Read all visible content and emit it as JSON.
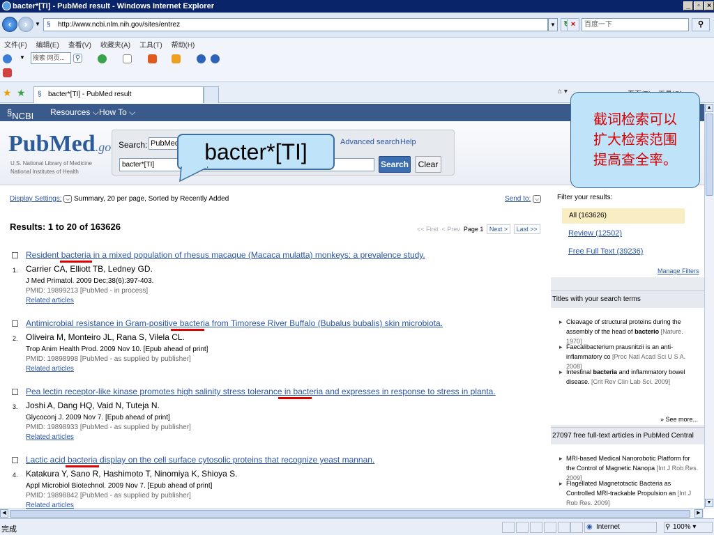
{
  "window": {
    "title": "bacter*[TI] - PubMed result - Windows Internet Explorer"
  },
  "address": {
    "url": "http://www.ncbi.nlm.nih.gov/sites/entrez",
    "search_placeholder": "百度一下"
  },
  "menu": [
    "文件(F)",
    "编辑(E)",
    "查看(V)",
    "收藏夹(A)",
    "工具(T)",
    "帮助(H)"
  ],
  "toolbar": {
    "search_label": "搜索 网页..."
  },
  "tab": {
    "label": "bacter*[TI] - PubMed result",
    "right_tools": "页面(P) ▾  工具(O) ▾"
  },
  "ncbi": {
    "brand": "NCBI",
    "resources": "Resources ⌵",
    "howto": "How To ⌵"
  },
  "pubmed": {
    "logo_pub": "Pub",
    "logo_med": "Med",
    "logo_gov": ".gov",
    "nlm1": "U.S. National Library of Medicine",
    "nlm2": "National Institutes of Health",
    "search_label": "Search:",
    "db_value": "PubMed",
    "advanced": "Advanced search",
    "help": "Help",
    "query": "bacter*[TI]",
    "search_btn": "Search",
    "clear_btn": "Clear"
  },
  "callout_query": "bacter*[TI]",
  "callout_note": [
    "截词检索可以",
    "扩大检索范围",
    "提高查全率。"
  ],
  "results_bar": {
    "display": "Display Settings:",
    "display_desc": "Summary, 20 per page, Sorted by Recently Added",
    "sendto": "Send to:",
    "count": "Results: 1 to 20 of 163626",
    "first": "<< First",
    "prev": "< Prev",
    "page": "Page 1",
    "next": "Next >",
    "last": "Last >>"
  },
  "results": [
    {
      "num": "1.",
      "title": "Resident bacteria in a mixed population of rhesus macaque (Macaca mulatta) monkeys: a prevalence study.",
      "authors": "Carrier CA, Elliott TB, Ledney GD.",
      "journal": "J Med Primatol. 2009 Dec;38(6):397-403.",
      "pmid": "PMID: 19899213 [PubMed - in process]",
      "related": "Related articles"
    },
    {
      "num": "2.",
      "title": "Antimicrobial resistance in Gram-positive bacteria from Timorese River Buffalo (Bubalus bubalis) skin microbiota.",
      "authors": "Oliveira M, Monteiro JL, Rana S, Vilela CL.",
      "journal": "Trop Anim Health Prod. 2009 Nov 10. [Epub ahead of print]",
      "pmid": "PMID: 19898998 [PubMed - as supplied by publisher]",
      "related": "Related articles"
    },
    {
      "num": "3.",
      "title": "Pea lectin receptor-like kinase promotes high salinity stress tolerance in bacteria and expresses in response to stress in planta.",
      "authors": "Joshi A, Dang HQ, Vaid N, Tuteja N.",
      "journal": "Glycoconj J. 2009 Nov 7. [Epub ahead of print]",
      "pmid": "PMID: 19898933 [PubMed - as supplied by publisher]",
      "related": "Related articles"
    },
    {
      "num": "4.",
      "title": "Lactic acid bacteria display on the cell surface cytosolic proteins that recognize yeast mannan.",
      "authors": "Katakura Y, Sano R, Hashimoto T, Ninomiya K, Shioya S.",
      "journal": "Appl Microbiol Biotechnol. 2009 Nov 7. [Epub ahead of print]",
      "pmid": "PMID: 19898842 [PubMed - as supplied by publisher]",
      "related": "Related articles"
    }
  ],
  "filters": {
    "title": "Filter your results:",
    "items": [
      "All (163626)",
      "Review (12502)",
      "Free Full Text (39236)"
    ],
    "manage": "Manage Filters"
  },
  "titles_box": {
    "heading": "Titles with your search terms",
    "items": [
      {
        "text": "Cleavage of structural proteins during the assembly of the head of",
        "bold": "bacterio",
        "cite": "[Nature. 1970]"
      },
      {
        "text": "Faecalibacterium prausnitzii is an anti-inflammatory co",
        "bold": "",
        "cite": "[Proc Natl Acad Sci U S A. 2008]"
      },
      {
        "text": "Intestinal",
        "bold": "bacteria",
        "text2": "and inflammatory bowel disease.",
        "cite": "[Crit Rev Clin Lab Sci. 2009]"
      }
    ],
    "see_more": "» See more..."
  },
  "pmc_box": {
    "heading": "27097 free full-text articles in PubMed Central",
    "items": [
      {
        "text": "MRI-based Medical Nanorobotic Platform for the Control of Magnetic Nanopa",
        "cite": "[Int J Rob Res. 2009]"
      },
      {
        "text": "Flagellated Magnetotactic Bacteria as Controlled MRI-trackable Propulsion an",
        "cite": "[Int J Rob Res. 2009]"
      }
    ]
  },
  "statusbar": {
    "text": "完成",
    "zone": "Internet",
    "zoom": "100%"
  },
  "colors": {
    "link": "#2b55a5",
    "ncbi_bar": "#3a5a8c",
    "highlight": "#e00000",
    "callout_fill": "#bfe3f8"
  }
}
